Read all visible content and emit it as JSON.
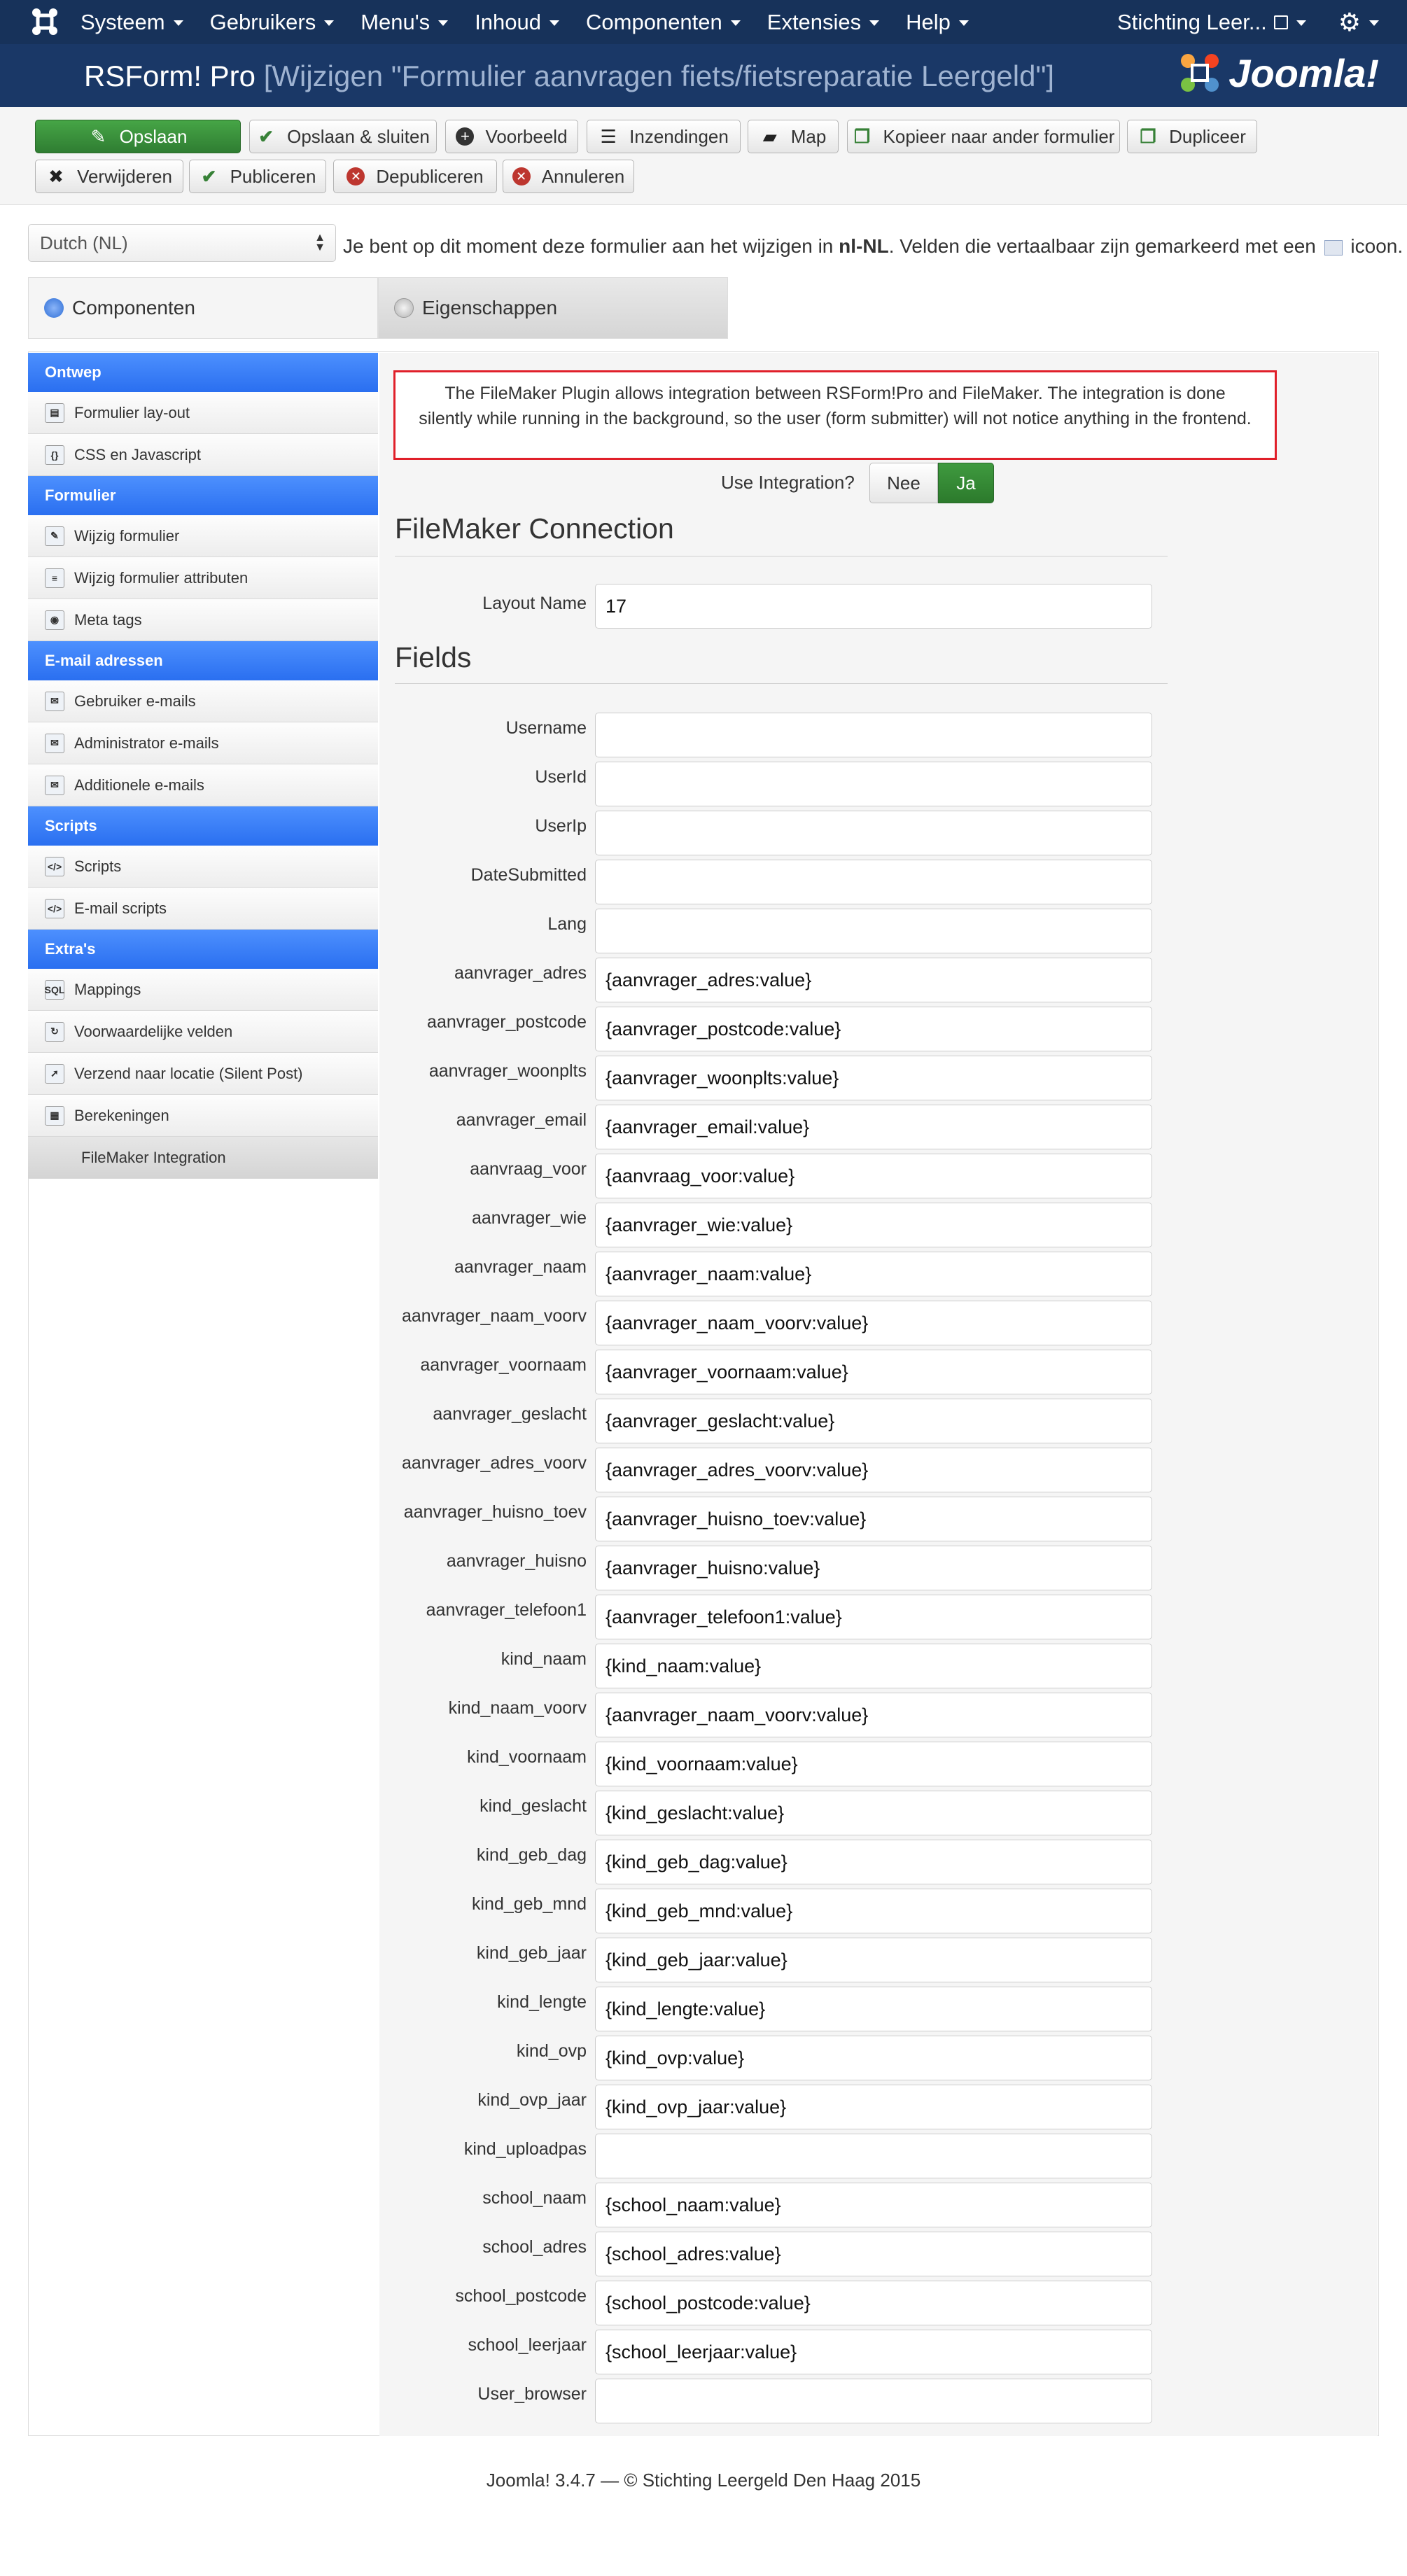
{
  "topnav": {
    "menu": [
      "Systeem",
      "Gebruikers",
      "Menu's",
      "Inhoud",
      "Componenten",
      "Extensies",
      "Help"
    ],
    "site_name": "Stichting Leer..."
  },
  "titlebar": {
    "app": "RSForm! Pro",
    "subtitle": "[Wijzigen \"Formulier aanvragen fiets/fietsreparatie Leergeld\"]",
    "brand": "Joomla!"
  },
  "toolbar": {
    "save": "Opslaan",
    "save_close": "Opslaan & sluiten",
    "preview": "Voorbeeld",
    "submissions": "Inzendingen",
    "directory": "Map",
    "copy": "Kopieer naar ander formulier",
    "duplicate": "Dupliceer",
    "delete": "Verwijderen",
    "publish": "Publiceren",
    "unpublish": "Depubliceren",
    "cancel": "Annuleren"
  },
  "language": {
    "selected": "Dutch (NL)",
    "note_pre": "Je bent op dit moment deze formulier aan het wijzigen in ",
    "note_code": "nl-NL",
    "note_post": ". Velden die vertaalbaar zijn gemarkeerd met een ",
    "note_end": " icoon."
  },
  "tabs": {
    "components": "Componenten",
    "properties": "Eigenschappen"
  },
  "sidebar": {
    "groups": [
      {
        "title": "Ontwep",
        "items": [
          "Formulier lay-out",
          "CSS en Javascript"
        ]
      },
      {
        "title": "Formulier",
        "items": [
          "Wijzig formulier",
          "Wijzig formulier attributen",
          "Meta tags"
        ]
      },
      {
        "title": "E-mail adressen",
        "items": [
          "Gebruiker e-mails",
          "Administrator e-mails",
          "Additionele e-mails"
        ]
      },
      {
        "title": "Scripts",
        "items": [
          "Scripts",
          "E-mail scripts"
        ]
      },
      {
        "title": "Extra's",
        "items": [
          "Mappings",
          "Voorwaardelijke velden",
          "Verzend naar locatie (Silent Post)",
          "Berekeningen",
          "FileMaker Integration"
        ]
      }
    ]
  },
  "panel": {
    "alert": "The FileMaker Plugin allows integration between RSForm!Pro and FileMaker. The integration is done silently while running in the background, so the user (form submitter) will not notice anything in the frontend.",
    "use_integration_label": "Use Integration?",
    "toggle_no": "Nee",
    "toggle_yes": "Ja",
    "toggle_selected": "Ja",
    "connection_title": "FileMaker Connection",
    "layout_label": "Layout Name",
    "layout_value": "17",
    "fields_title": "Fields",
    "fields": [
      {
        "label": "Username",
        "value": ""
      },
      {
        "label": "UserId",
        "value": ""
      },
      {
        "label": "UserIp",
        "value": ""
      },
      {
        "label": "DateSubmitted",
        "value": ""
      },
      {
        "label": "Lang",
        "value": ""
      },
      {
        "label": "aanvrager_adres",
        "value": "{aanvrager_adres:value}"
      },
      {
        "label": "aanvrager_postcode",
        "value": "{aanvrager_postcode:value}"
      },
      {
        "label": "aanvrager_woonplts",
        "value": "{aanvrager_woonplts:value}"
      },
      {
        "label": "aanvrager_email",
        "value": "{aanvrager_email:value}"
      },
      {
        "label": "aanvraag_voor",
        "value": "{aanvraag_voor:value}"
      },
      {
        "label": "aanvrager_wie",
        "value": "{aanvrager_wie:value}"
      },
      {
        "label": "aanvrager_naam",
        "value": "{aanvrager_naam:value}"
      },
      {
        "label": "aanvrager_naam_voorv",
        "value": "{aanvrager_naam_voorv:value}"
      },
      {
        "label": "aanvrager_voornaam",
        "value": "{aanvrager_voornaam:value}"
      },
      {
        "label": "aanvrager_geslacht",
        "value": "{aanvrager_geslacht:value}"
      },
      {
        "label": "aanvrager_adres_voorv",
        "value": "{aanvrager_adres_voorv:value}"
      },
      {
        "label": "aanvrager_huisno_toev",
        "value": "{aanvrager_huisno_toev:value}"
      },
      {
        "label": "aanvrager_huisno",
        "value": "{aanvrager_huisno:value}"
      },
      {
        "label": "aanvrager_telefoon1",
        "value": "{aanvrager_telefoon1:value}"
      },
      {
        "label": "kind_naam",
        "value": "{kind_naam:value}"
      },
      {
        "label": "kind_naam_voorv",
        "value": "{aanvrager_naam_voorv:value}"
      },
      {
        "label": "kind_voornaam",
        "value": "{kind_voornaam:value}"
      },
      {
        "label": "kind_geslacht",
        "value": "{kind_geslacht:value}"
      },
      {
        "label": "kind_geb_dag",
        "value": "{kind_geb_dag:value}"
      },
      {
        "label": "kind_geb_mnd",
        "value": "{kind_geb_mnd:value}"
      },
      {
        "label": "kind_geb_jaar",
        "value": "{kind_geb_jaar:value}"
      },
      {
        "label": "kind_lengte",
        "value": "{kind_lengte:value}"
      },
      {
        "label": "kind_ovp",
        "value": "{kind_ovp:value}"
      },
      {
        "label": "kind_ovp_jaar",
        "value": "{kind_ovp_jaar:value}"
      },
      {
        "label": "kind_uploadpas",
        "value": ""
      },
      {
        "label": "school_naam",
        "value": "{school_naam:value}"
      },
      {
        "label": "school_adres",
        "value": "{school_adres:value}"
      },
      {
        "label": "school_postcode",
        "value": "{school_postcode:value}"
      },
      {
        "label": "school_leerjaar",
        "value": "{school_leerjaar:value}"
      },
      {
        "label": "User_browser",
        "value": ""
      }
    ]
  },
  "footer": "Joomla! 3.4.7  —  © Stichting Leergeld Den Haag 2015",
  "colors": {
    "nav_bg": "#17325a",
    "title_bg": "#1a3867",
    "save_green": "#3b8c3b",
    "sidebar_header_blue": "#3a7ff5",
    "alert_red": "#e0202a"
  }
}
